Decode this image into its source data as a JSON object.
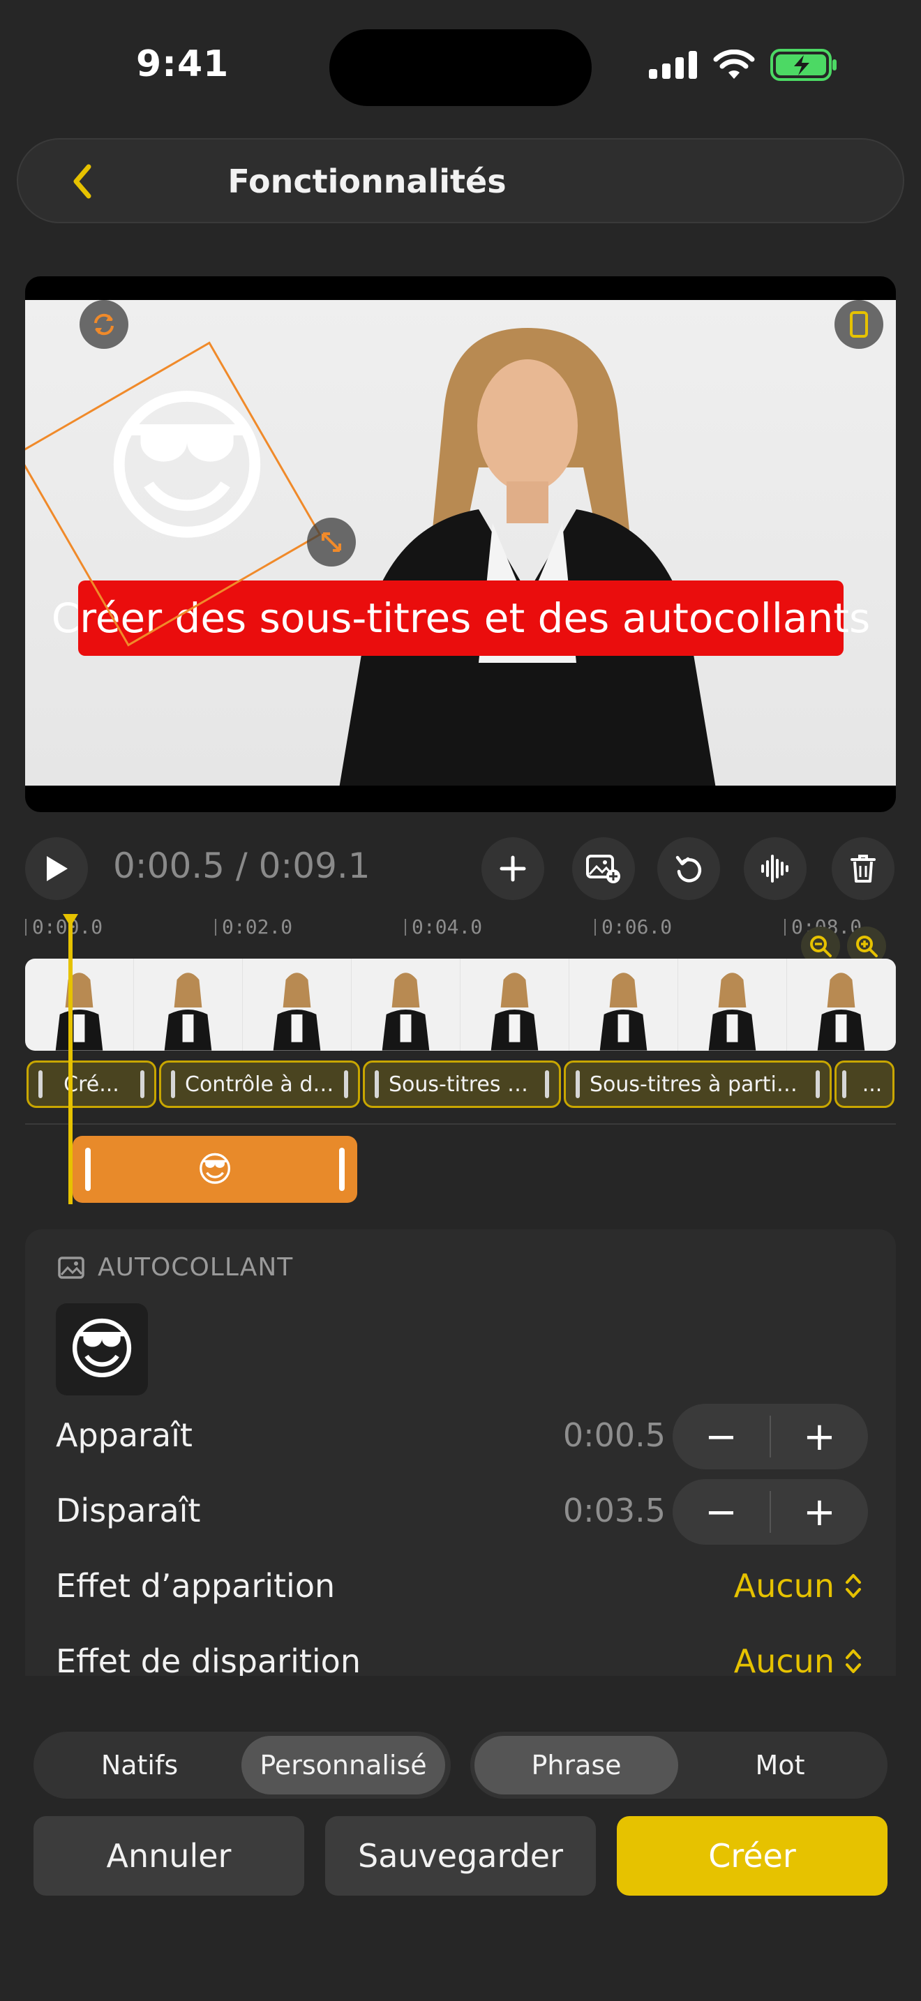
{
  "status_bar": {
    "time": "9:41"
  },
  "navbar": {
    "title": "Fonctionnalités"
  },
  "video": {
    "caption": "Créer des sous-titres et des autocollants",
    "sticker_emoji": "😎"
  },
  "playback": {
    "timecode": "0:00.5 / 0:09.1"
  },
  "ruler": [
    "0:00.0",
    "0:02.0",
    "0:04.0",
    "0:06.0",
    "0:08.0"
  ],
  "caption_clips": [
    {
      "label": "Cré..."
    },
    {
      "label": "Contrôle à dist..."
    },
    {
      "label": "Sous-titres au..."
    },
    {
      "label": "Sous-titres à partir d..."
    },
    {
      "label": "..."
    }
  ],
  "sticker_clip": {
    "emoji": "😎"
  },
  "panel": {
    "section_title": "AUTOCOLLANT",
    "sticker_emoji": "😎",
    "appear_label": "Apparaît",
    "appear_value": "0:00.5",
    "disappear_label": "Disparaît",
    "disappear_value": "0:03.5",
    "entry_effect_label": "Effet d’apparition",
    "entry_effect_value": "Aucun",
    "exit_effect_label": "Effet de disparition",
    "exit_effect_value": "Aucun",
    "minus": "−",
    "plus": "+"
  },
  "segments": {
    "style": {
      "options": [
        "Natifs",
        "Personnalisé"
      ],
      "selected": "Personnalisé"
    },
    "mode": {
      "options": [
        "Phrase",
        "Mot"
      ],
      "selected": "Phrase"
    }
  },
  "actions": {
    "cancel": "Annuler",
    "save": "Sauvegarder",
    "create": "Créer"
  },
  "colors": {
    "accent": "#e6c200",
    "sticker_clip": "#e88a2a",
    "caption_bg": "#ea0d0d",
    "battery": "#4cd964"
  }
}
